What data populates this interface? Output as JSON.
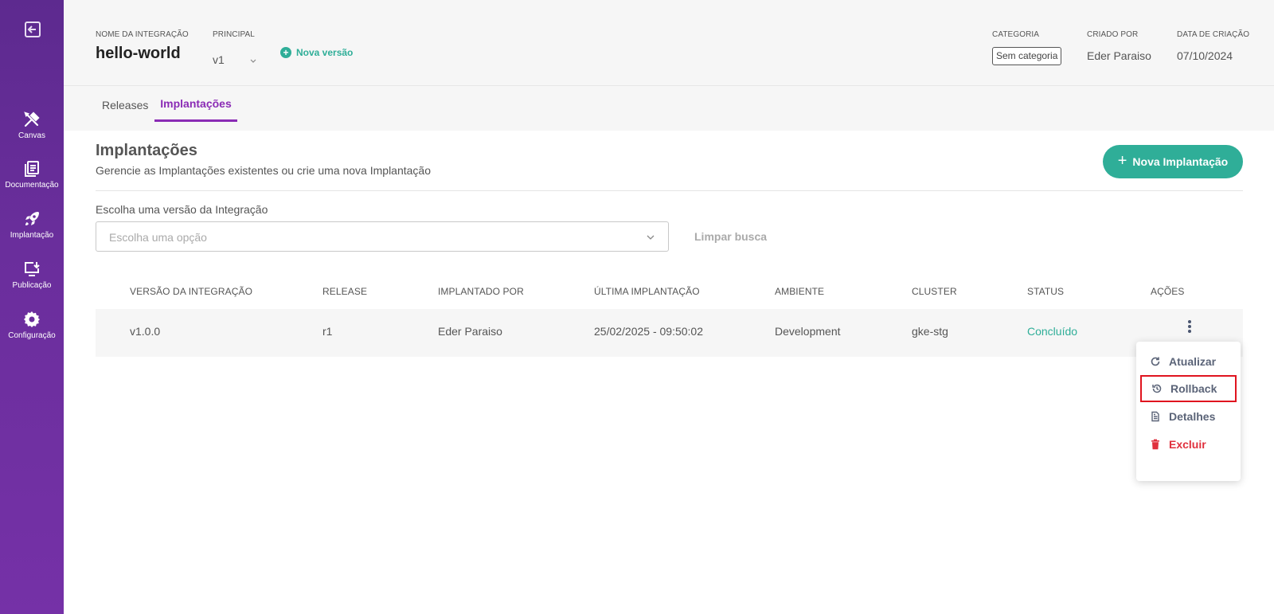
{
  "sidebar": {
    "items": [
      {
        "label": "Canvas",
        "icon": "tools-icon"
      },
      {
        "label": "Documentação",
        "icon": "documents-icon"
      },
      {
        "label": "Implantação",
        "icon": "rocket-icon"
      },
      {
        "label": "Publicação",
        "icon": "publish-icon"
      },
      {
        "label": "Configuração",
        "icon": "gear-icon"
      }
    ]
  },
  "header": {
    "integration_name_label": "NOME DA INTEGRAÇÃO",
    "integration_name": "hello-world",
    "principal_label": "PRINCIPAL",
    "version": "v1",
    "new_version": "Nova versão",
    "category_label": "CATEGORIA",
    "category": "Sem categoria",
    "created_by_label": "CRIADO POR",
    "created_by": "Eder Paraiso",
    "created_at_label": "DATA DE CRIAÇÃO",
    "created_at": "07/10/2024"
  },
  "tabs": {
    "releases": "Releases",
    "deployments": "Implantações"
  },
  "page": {
    "title": "Implantações",
    "subtitle": "Gerencie as Implantações existentes ou crie uma nova Implantação",
    "new_button": "Nova Implantação",
    "select_label": "Escolha uma versão da Integração",
    "select_placeholder": "Escolha uma opção",
    "clear_search": "Limpar busca"
  },
  "table": {
    "headers": [
      "VERSÃO DA INTEGRAÇÃO",
      "RELEASE",
      "IMPLANTADO POR",
      "ÚLTIMA IMPLANTAÇÃO",
      "AMBIENTE",
      "CLUSTER",
      "STATUS",
      "AÇÕES"
    ],
    "rows": [
      {
        "version": "v1.0.0",
        "release": "r1",
        "deployed_by": "Eder Paraiso",
        "last_deploy": "25/02/2025 - 09:50:02",
        "environment": "Development",
        "cluster": "gke-stg",
        "status": "Concluído"
      }
    ]
  },
  "actions_menu": {
    "update": "Atualizar",
    "rollback": "Rollback",
    "details": "Detalhes",
    "delete": "Excluir"
  },
  "colors": {
    "sidebar": "#6a2e9c",
    "accent": "#2fae98",
    "tab_active": "#8a2bb5",
    "danger": "#e0303d"
  }
}
